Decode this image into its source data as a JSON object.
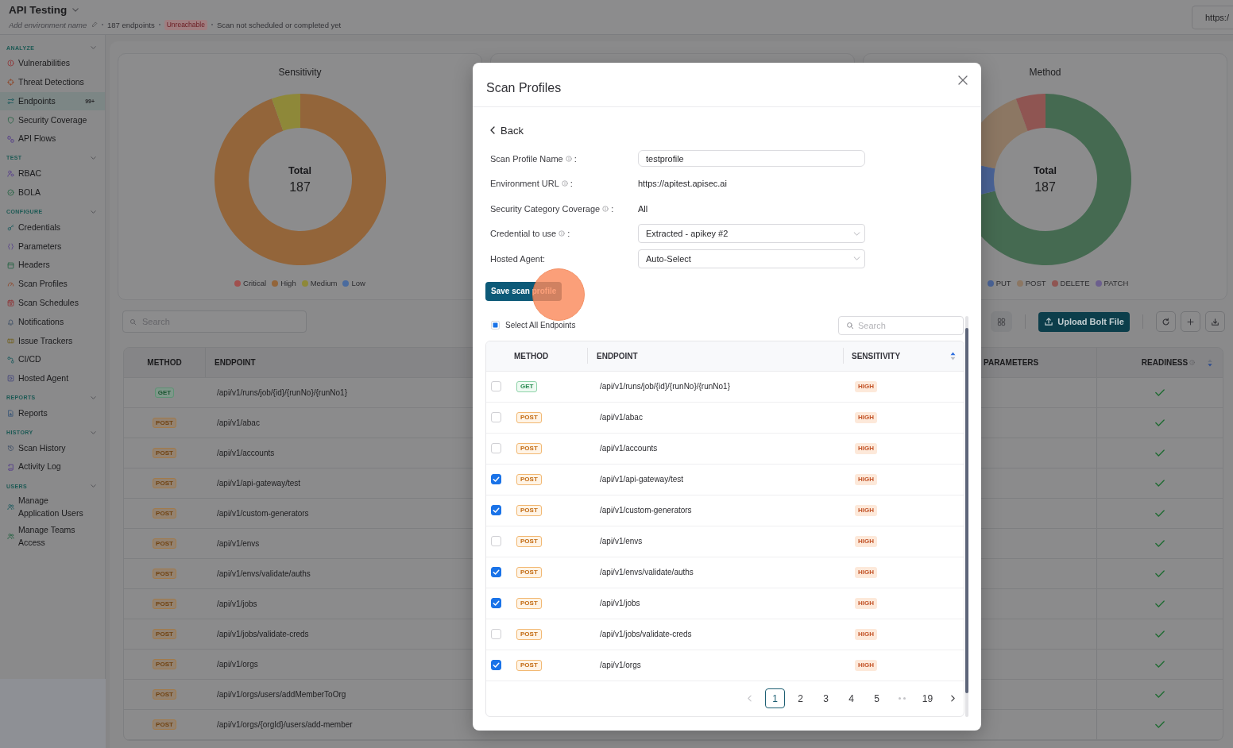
{
  "header": {
    "title": "API Testing",
    "environment_name": {
      "placeholder": "Add environment name"
    },
    "endpoint_count": "187 endpoints",
    "status": "Unreachable",
    "scan_status": "Scan not scheduled or completed yet",
    "environment_url": "https:/"
  },
  "sidebar": {
    "sections": [
      {
        "title": "ANALYZE",
        "expanded": true,
        "items": [
          {
            "label": "Vulnerabilities",
            "selected": false
          },
          {
            "label": "Threat Detections",
            "selected": false
          },
          {
            "label": "Endpoints",
            "selected": true,
            "badge": "99+"
          },
          {
            "label": "Security Coverage",
            "selected": false
          },
          {
            "label": "API Flows",
            "selected": false
          }
        ]
      },
      {
        "title": "TEST",
        "expanded": true,
        "items": [
          {
            "label": "RBAC",
            "selected": false
          },
          {
            "label": "BOLA",
            "selected": false
          }
        ]
      },
      {
        "title": "CONFIGURE",
        "expanded": true,
        "items": [
          {
            "label": "Credentials",
            "selected": false
          },
          {
            "label": "Parameters",
            "selected": false
          },
          {
            "label": "Headers",
            "selected": false
          },
          {
            "label": "Scan Profiles",
            "selected": false
          },
          {
            "label": "Scan Schedules",
            "selected": false
          },
          {
            "label": "Notifications",
            "selected": false
          },
          {
            "label": "Issue Trackers",
            "selected": false
          },
          {
            "label": "CI/CD",
            "selected": false
          },
          {
            "label": "Hosted Agent",
            "selected": false
          }
        ]
      },
      {
        "title": "REPORTS",
        "expanded": true,
        "items": [
          {
            "label": "Reports",
            "selected": false
          }
        ]
      },
      {
        "title": "HISTORY",
        "expanded": true,
        "items": [
          {
            "label": "Scan History",
            "selected": false
          },
          {
            "label": "Activity Log",
            "selected": false
          }
        ]
      },
      {
        "title": "USERS",
        "expanded": true,
        "items": [
          {
            "label": "Manage Application Users",
            "selected": false
          },
          {
            "label": "Manage Teams Access",
            "selected": false
          }
        ]
      }
    ]
  },
  "charts": [
    {
      "title": "Sensitivity",
      "total_label": "Total",
      "total": "187",
      "legend": [
        {
          "label": "Critical",
          "color": "#a0504e"
        },
        {
          "label": "High",
          "color": "#93653a"
        },
        {
          "label": "Medium",
          "color": "#8e8839"
        },
        {
          "label": "Low",
          "color": "#4a6b9e"
        }
      ]
    },
    {
      "title": "Method",
      "total_label": "Total",
      "total": "187",
      "legend": [
        {
          "label": "PUT",
          "color": "#4a6396"
        },
        {
          "label": "POST",
          "color": "#8c7763"
        },
        {
          "label": "DELETE",
          "color": "#8f5552"
        },
        {
          "label": "PATCH",
          "color": "#6c5f8e"
        }
      ]
    }
  ],
  "toolbar": {
    "search": {
      "placeholder": "Search"
    },
    "upload_button": "Upload Bolt File"
  },
  "table": {
    "columns": [
      "METHOD",
      "ENDPOINT",
      "PARAMETERS",
      "READINESS"
    ],
    "rows": [
      {
        "method": "GET",
        "kind": "get",
        "endpoint": "/api/v1/runs/job/{id}/{runNo}/{runNo1}",
        "ready": true
      },
      {
        "method": "POST",
        "kind": "post",
        "endpoint": "/api/v1/abac",
        "ready": true
      },
      {
        "method": "POST",
        "kind": "post",
        "endpoint": "/api/v1/accounts",
        "ready": true
      },
      {
        "method": "POST",
        "kind": "post",
        "endpoint": "/api/v1/api-gateway/test",
        "ready": true
      },
      {
        "method": "POST",
        "kind": "post",
        "endpoint": "/api/v1/custom-generators",
        "ready": true
      },
      {
        "method": "POST",
        "kind": "post",
        "endpoint": "/api/v1/envs",
        "ready": true
      },
      {
        "method": "POST",
        "kind": "post",
        "endpoint": "/api/v1/envs/validate/auths",
        "ready": true
      },
      {
        "method": "POST",
        "kind": "post",
        "endpoint": "/api/v1/jobs",
        "ready": true
      },
      {
        "method": "POST",
        "kind": "post",
        "endpoint": "/api/v1/jobs/validate-creds",
        "ready": true
      },
      {
        "method": "POST",
        "kind": "post",
        "endpoint": "/api/v1/orgs",
        "ready": true
      },
      {
        "method": "POST",
        "kind": "post",
        "endpoint": "/api/v1/orgs/users/addMemberToOrg",
        "ready": true
      },
      {
        "method": "POST",
        "kind": "post",
        "endpoint": "/api/v1/orgs/{orgId}/users/add-member",
        "ready": true
      }
    ]
  },
  "modal": {
    "title": "Scan Profiles",
    "back": "Back",
    "fields": [
      {
        "label": "Scan Profile Name",
        "info": true,
        "separator": ":",
        "kind": "input",
        "value": "testprofile"
      },
      {
        "label": "Environment URL",
        "info": true,
        "separator": ":",
        "kind": "text",
        "value": "https://apitest.apisec.ai"
      },
      {
        "label": "Security Category Coverage",
        "info": true,
        "separator": ":",
        "kind": "text",
        "value": "All"
      },
      {
        "label": "Credential to use",
        "info": true,
        "separator": ":",
        "kind": "select",
        "value": "Extracted - apikey #2"
      },
      {
        "label": "Hosted Agent:",
        "info": false,
        "kind": "select",
        "value": "Auto-Select"
      }
    ],
    "save_button": "Save scan profile",
    "select_all": {
      "label": "Select All Endpoints",
      "checked": false,
      "indeterminate": true
    },
    "search": {
      "placeholder": "Search"
    },
    "columns": [
      "METHOD",
      "ENDPOINT",
      "SENSITIVITY"
    ],
    "rows": [
      {
        "checked": false,
        "method": "GET",
        "kind": "get",
        "endpoint": "/api/v1/runs/job/{id}/{runNo}/{runNo1}",
        "sensitivity": "HIGH"
      },
      {
        "checked": false,
        "method": "POST",
        "kind": "post",
        "endpoint": "/api/v1/abac",
        "sensitivity": "HIGH"
      },
      {
        "checked": false,
        "method": "POST",
        "kind": "post",
        "endpoint": "/api/v1/accounts",
        "sensitivity": "HIGH"
      },
      {
        "checked": true,
        "method": "POST",
        "kind": "post",
        "endpoint": "/api/v1/api-gateway/test",
        "sensitivity": "HIGH"
      },
      {
        "checked": true,
        "method": "POST",
        "kind": "post",
        "endpoint": "/api/v1/custom-generators",
        "sensitivity": "HIGH"
      },
      {
        "checked": false,
        "method": "POST",
        "kind": "post",
        "endpoint": "/api/v1/envs",
        "sensitivity": "HIGH"
      },
      {
        "checked": true,
        "method": "POST",
        "kind": "post",
        "endpoint": "/api/v1/envs/validate/auths",
        "sensitivity": "HIGH"
      },
      {
        "checked": true,
        "method": "POST",
        "kind": "post",
        "endpoint": "/api/v1/jobs",
        "sensitivity": "HIGH"
      },
      {
        "checked": false,
        "method": "POST",
        "kind": "post",
        "endpoint": "/api/v1/jobs/validate-creds",
        "sensitivity": "HIGH"
      },
      {
        "checked": true,
        "method": "POST",
        "kind": "post",
        "endpoint": "/api/v1/orgs",
        "sensitivity": "HIGH"
      }
    ],
    "pagination": {
      "previous": {
        "disabled": true
      },
      "next": {
        "disabled": false
      },
      "pages": [
        {
          "kind": "page",
          "label": "1",
          "selected": true
        },
        {
          "kind": "page",
          "label": "2",
          "selected": false
        },
        {
          "kind": "page",
          "label": "3",
          "selected": false
        },
        {
          "kind": "page",
          "label": "4",
          "selected": false
        },
        {
          "kind": "page",
          "label": "5",
          "selected": false
        },
        {
          "kind": "ellipsis"
        },
        {
          "kind": "page",
          "label": "19",
          "selected": false
        }
      ]
    }
  }
}
